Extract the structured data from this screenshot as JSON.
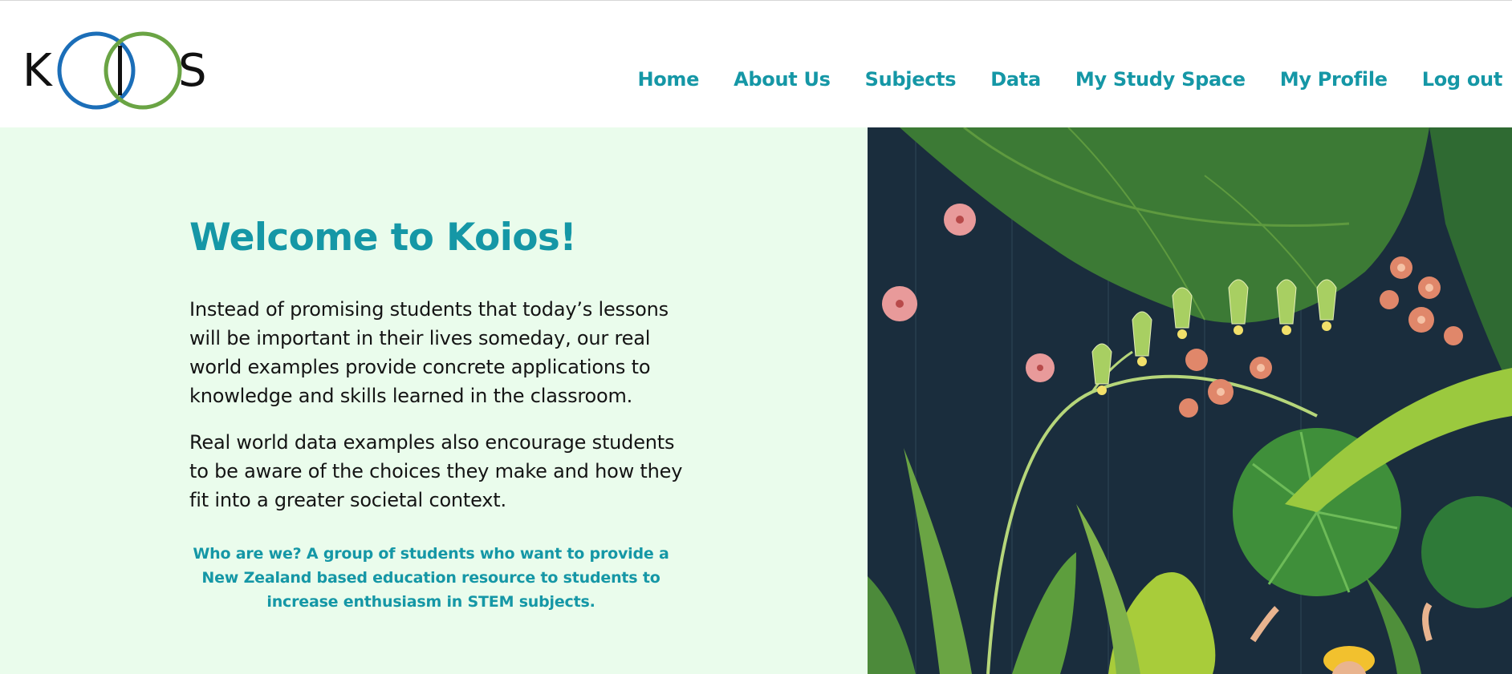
{
  "header": {
    "logo_text": "KOIS",
    "logo_colors": {
      "left_ring": "#1b6eb8",
      "right_ring": "#6aa444",
      "letters": "#111111"
    },
    "nav": [
      {
        "label": "Home"
      },
      {
        "label": "About Us"
      },
      {
        "label": "Subjects"
      },
      {
        "label": "Data"
      },
      {
        "label": "My Study Space"
      },
      {
        "label": "My Profile"
      },
      {
        "label": "Log out"
      }
    ]
  },
  "hero": {
    "title": "Welcome to Koios!",
    "paragraph_1": "Instead of promising students that today’s lessons will be important in their lives someday, our real world examples provide concrete applications to knowledge and skills learned in the classroom.",
    "paragraph_2": "Real world data examples also encourage students to be aware of the choices they make and how they fit into a greater societal context.",
    "who_we_are": "Who are we? A group of students who want to provide a New Zealand based education resource to students to increase enthusiasm in STEM subjects.",
    "illustration_icon": "botanical-illustration"
  },
  "colors": {
    "accent": "#1597a6",
    "hero_background": "#eafcec",
    "illustration_background": "#1a2d3d"
  }
}
